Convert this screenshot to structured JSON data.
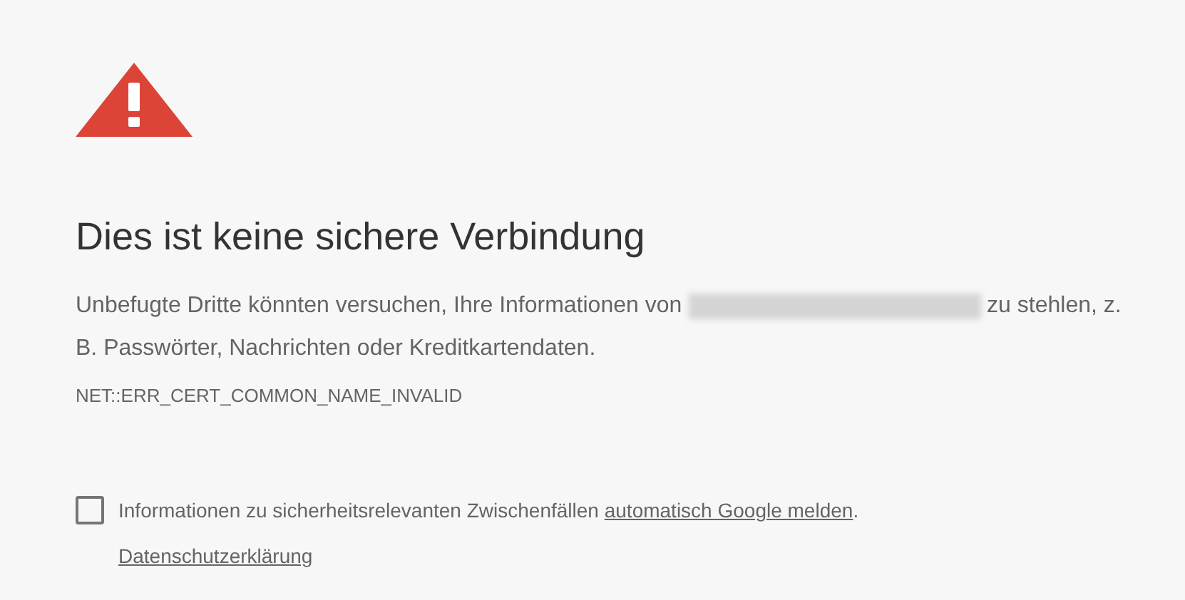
{
  "heading": "Dies ist keine sichere Verbindung",
  "message": {
    "before": "Unbefugte Dritte könnten versuchen, Ihre Informationen von",
    "after": "zu stehlen, z. B. Passwörter, Nachrichten oder Kreditkartendaten."
  },
  "error_code": "NET::ERR_CERT_COMMON_NAME_INVALID",
  "report": {
    "checked": false,
    "text": "Informationen zu sicherheitsrelevanten Zwischenfällen",
    "link": "automatisch Google melden",
    "end": "."
  },
  "privacy_link": "Datenschutzerklärung"
}
